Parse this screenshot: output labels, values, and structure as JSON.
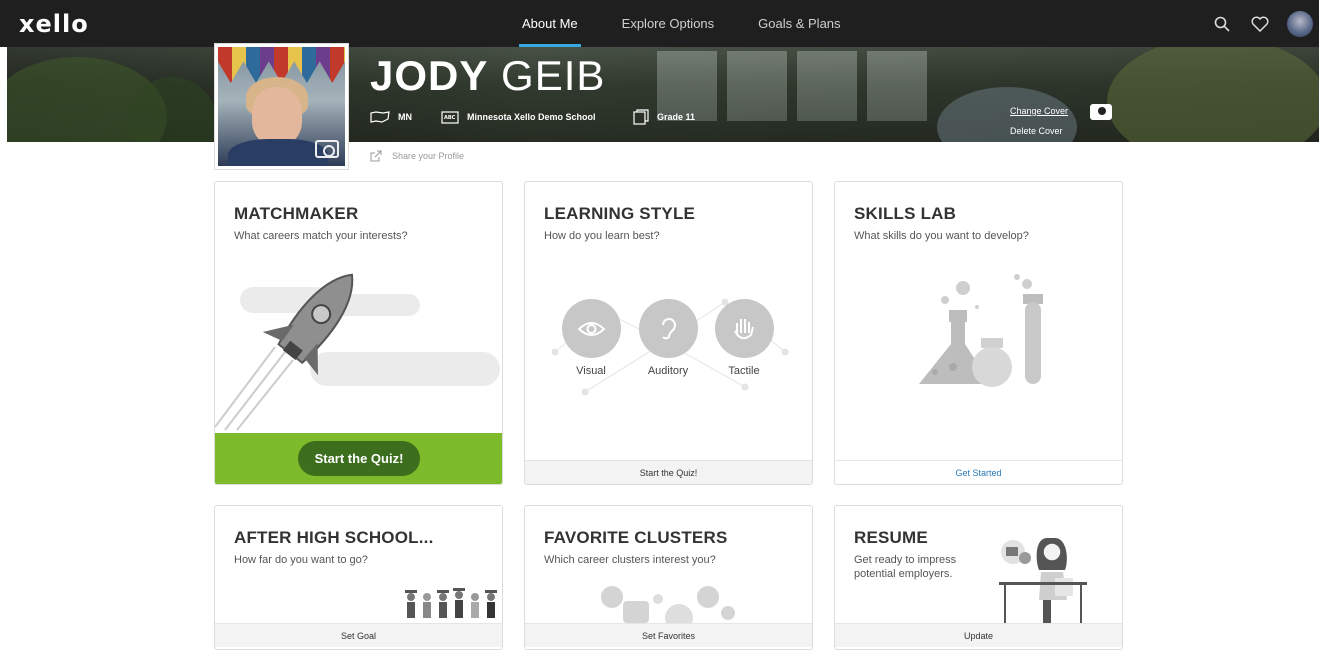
{
  "nav": {
    "logo": "xello",
    "tabs": [
      {
        "label": "About Me",
        "active": true
      },
      {
        "label": "Explore Options",
        "active": false
      },
      {
        "label": "Goals & Plans",
        "active": false
      }
    ],
    "icons": [
      "search-icon",
      "heart-icon",
      "avatar"
    ]
  },
  "profile": {
    "first_name": "JODY",
    "last_name": "GEIB",
    "state": "MN",
    "school": "Minnesota Xello Demo School",
    "grade": "Grade 11",
    "share_label": "Share your Profile",
    "change_cover": "Change Cover",
    "delete_cover": "Delete Cover"
  },
  "cards": {
    "matchmaker": {
      "title": "MATCHMAKER",
      "subtitle": "What careers match your interests?",
      "button": "Start the Quiz!"
    },
    "learning_style": {
      "title": "LEARNING STYLE",
      "subtitle": "How do you learn best?",
      "styles": [
        "Visual",
        "Auditory",
        "Tactile"
      ],
      "footer": "Start the Quiz!"
    },
    "skills_lab": {
      "title": "SKILLS LAB",
      "subtitle": "What skills do you want to develop?",
      "footer": "Get Started"
    },
    "after_high_school": {
      "title": "AFTER HIGH SCHOOL...",
      "subtitle": "How far do you want to go?",
      "footer": "Set Goal"
    },
    "favorite_clusters": {
      "title": "FAVORITE CLUSTERS",
      "subtitle": "Which career clusters interest you?",
      "footer": "Set Favorites"
    },
    "resume": {
      "title": "RESUME",
      "subtitle_line1": "Get ready to impress",
      "subtitle_line2": "potential employers.",
      "footer": "Update"
    }
  },
  "colors": {
    "nav_bg": "#1f1f1f",
    "accent_blue": "#36a9e1",
    "quiz_green": "#7dbb2b",
    "quiz_button": "#3d6e1d",
    "link": "#2a7ab8"
  }
}
